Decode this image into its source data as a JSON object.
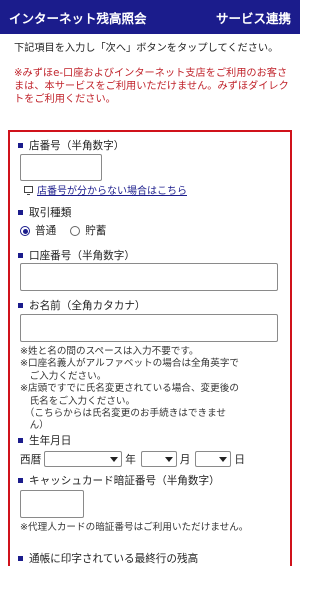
{
  "header": {
    "title": "インターネット残高照会",
    "subtitle": "サービス連携"
  },
  "intro_text": "下記項目を入力し「次へ」ボタンをタップしてください。",
  "notice_text": "※みずほe-口座およびインターネット支店をご利用のお客さまは、本サービスをご利用いただけません。みずほダイレクトをご利用ください。",
  "form": {
    "branch": {
      "label": "店番号（半角数字）",
      "link": "店番号が分からない場合はこちら",
      "value": ""
    },
    "transaction_type": {
      "label": "取引種類",
      "options": [
        "普通",
        "貯蓄"
      ],
      "selected": "普通"
    },
    "account_number": {
      "label": "口座番号（半角数字）",
      "value": ""
    },
    "name": {
      "label": "お名前（全角カタカナ）",
      "value": "",
      "notes": [
        "※姓と名の間のスペースは入力不要です。",
        "※口座名義人がアルファベットの場合は全角英字で",
        "　ご入力ください。",
        "※店頭ですでに氏名変更されている場合、変更後の",
        "　氏名をご入力ください。",
        "　（こちらからは氏名変更のお手続きはできませ",
        "　ん）"
      ]
    },
    "dob": {
      "label": "生年月日",
      "era": "西暦",
      "year_unit": "年",
      "month_unit": "月",
      "day_unit": "日"
    },
    "pin": {
      "label": "キャッシュカード暗証番号（半角数字）",
      "value": "",
      "note": "※代理人カードの暗証番号はご利用いただけません。"
    },
    "balance": {
      "label": "通帳に印字されている最終行の残高"
    }
  }
}
